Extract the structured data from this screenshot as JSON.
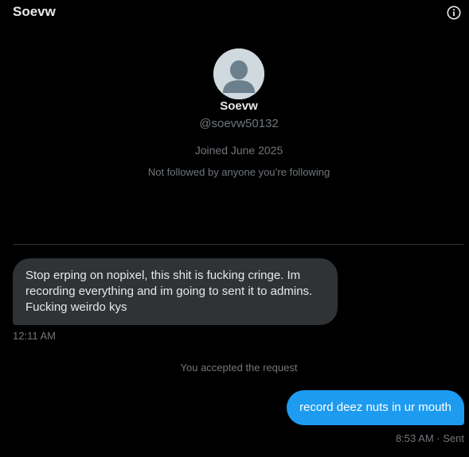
{
  "header": {
    "title": "Soevw",
    "info_icon": "info-circle-icon"
  },
  "profile": {
    "avatar_icon": "default-avatar-icon",
    "name": "Soevw",
    "handle": "@soevw50132",
    "joined": "Joined June 2025",
    "follow_context": "Not followed by anyone you’re following"
  },
  "messages": [
    {
      "direction": "incoming",
      "text": "Stop erping on nopixel, this shit is fucking cringe. Im recording everything and im going to sent it to admins. Fucking weirdo kys",
      "time": "12:11 AM"
    },
    {
      "direction": "system",
      "text": "You accepted the request"
    },
    {
      "direction": "outgoing",
      "text": "record deez nuts in ur mouth",
      "time": "8:53 AM",
      "status": "Sent",
      "separator": "·"
    }
  ],
  "colors": {
    "background": "#000000",
    "text_primary": "#e7e9ea",
    "text_secondary": "#71767b",
    "incoming_bubble": "#2f3336",
    "outgoing_bubble": "#1d9bf0",
    "avatar_bg": "#cfd9de",
    "avatar_fg": "#6b7f8c"
  }
}
